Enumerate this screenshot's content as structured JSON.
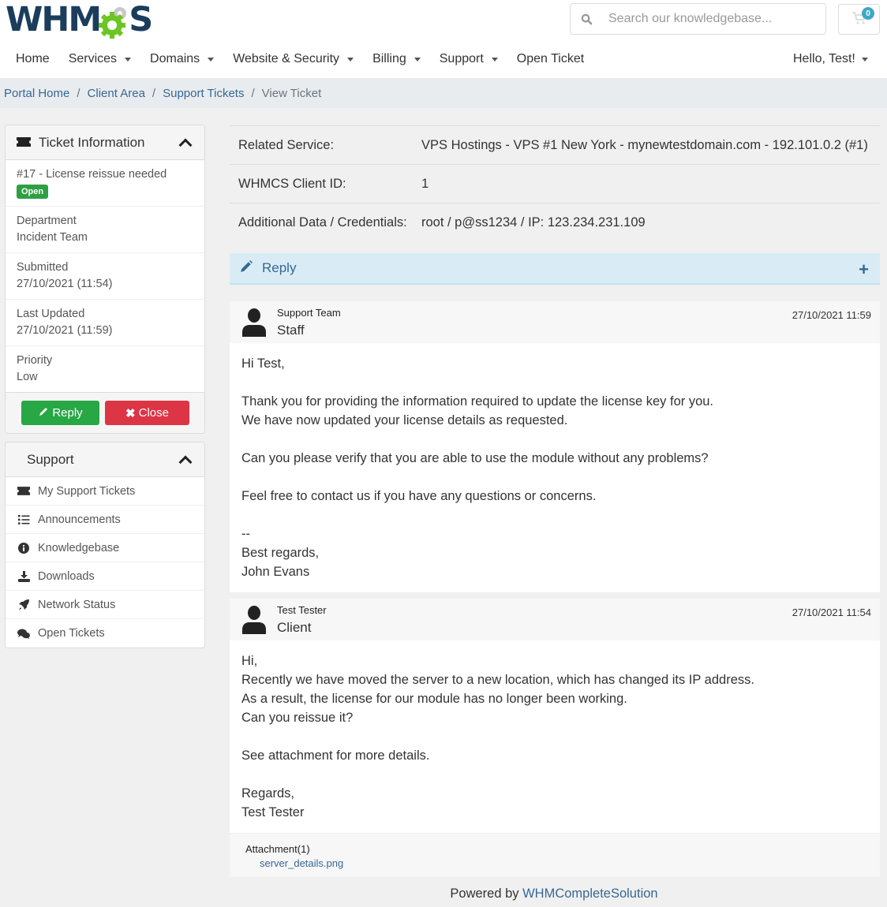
{
  "header": {
    "logo": {
      "text_before": "WHM",
      "text_after": "S"
    },
    "search_placeholder": "Search our knowledgebase...",
    "cart_count": "0"
  },
  "nav": {
    "items": [
      {
        "label": "Home",
        "dropdown": false
      },
      {
        "label": "Services",
        "dropdown": true
      },
      {
        "label": "Domains",
        "dropdown": true
      },
      {
        "label": "Website & Security",
        "dropdown": true
      },
      {
        "label": "Billing",
        "dropdown": true
      },
      {
        "label": "Support",
        "dropdown": true
      },
      {
        "label": "Open Ticket",
        "dropdown": false
      }
    ],
    "user_greeting": "Hello, Test!"
  },
  "breadcrumb": {
    "items": [
      "Portal Home",
      "Client Area",
      "Support Tickets"
    ],
    "current": "View Ticket",
    "separator": "/"
  },
  "ticket_info": {
    "title": "Ticket Information",
    "subject": "#17 - License reissue needed",
    "status": "Open",
    "status_color": "#2ea043",
    "fields": [
      {
        "label": "Department",
        "value": "Incident Team"
      },
      {
        "label": "Submitted",
        "value": "27/10/2021 (11:54)"
      },
      {
        "label": "Last Updated",
        "value": "27/10/2021 (11:59)"
      },
      {
        "label": "Priority",
        "value": "Low"
      }
    ],
    "reply_label": "Reply",
    "close_label": "Close"
  },
  "support_panel": {
    "title": "Support",
    "items": [
      {
        "label": "My Support Tickets",
        "icon": "ticket-icon"
      },
      {
        "label": "Announcements",
        "icon": "list-icon"
      },
      {
        "label": "Knowledgebase",
        "icon": "info-icon"
      },
      {
        "label": "Downloads",
        "icon": "download-icon"
      },
      {
        "label": "Network Status",
        "icon": "rocket-icon"
      },
      {
        "label": "Open Tickets",
        "icon": "comments-icon"
      }
    ]
  },
  "properties": [
    {
      "label": "Related Service:",
      "value": "VPS Hostings - VPS #1 New York - mynewtestdomain.com - 192.101.0.2 (#1)"
    },
    {
      "label": "WHMCS Client ID:",
      "value": "1"
    },
    {
      "label": "Additional Data / Credentials:",
      "value": "root / p@ss1234 / IP: 123.234.231.109"
    }
  ],
  "reply_bar": {
    "label": "Reply"
  },
  "messages": [
    {
      "name": "Support Team",
      "role": "Staff",
      "date": "27/10/2021 11:59",
      "body": "Hi Test,\n\nThank you for providing the information required to update the license key for you.\nWe have now updated your license details as requested.\n\nCan you please verify that you are able to use the module without any problems?\n\nFeel free to contact us if you have any questions or concerns.\n\n--\nBest regards,\nJohn Evans"
    },
    {
      "name": "Test Tester",
      "role": "Client",
      "date": "27/10/2021 11:54",
      "body": "Hi,\nRecently we have moved the server to a new location, which has changed its IP address.\nAs a result, the license for our module has no longer been working.\nCan you reissue it?\n\nSee attachment for more details.\n\nRegards,\nTest Tester",
      "attachment_title": "Attachment(1)",
      "attachment_file": "server_details.png"
    }
  ],
  "footer": {
    "prefix": "Powered by ",
    "link": "WHMCompleteSolution"
  }
}
